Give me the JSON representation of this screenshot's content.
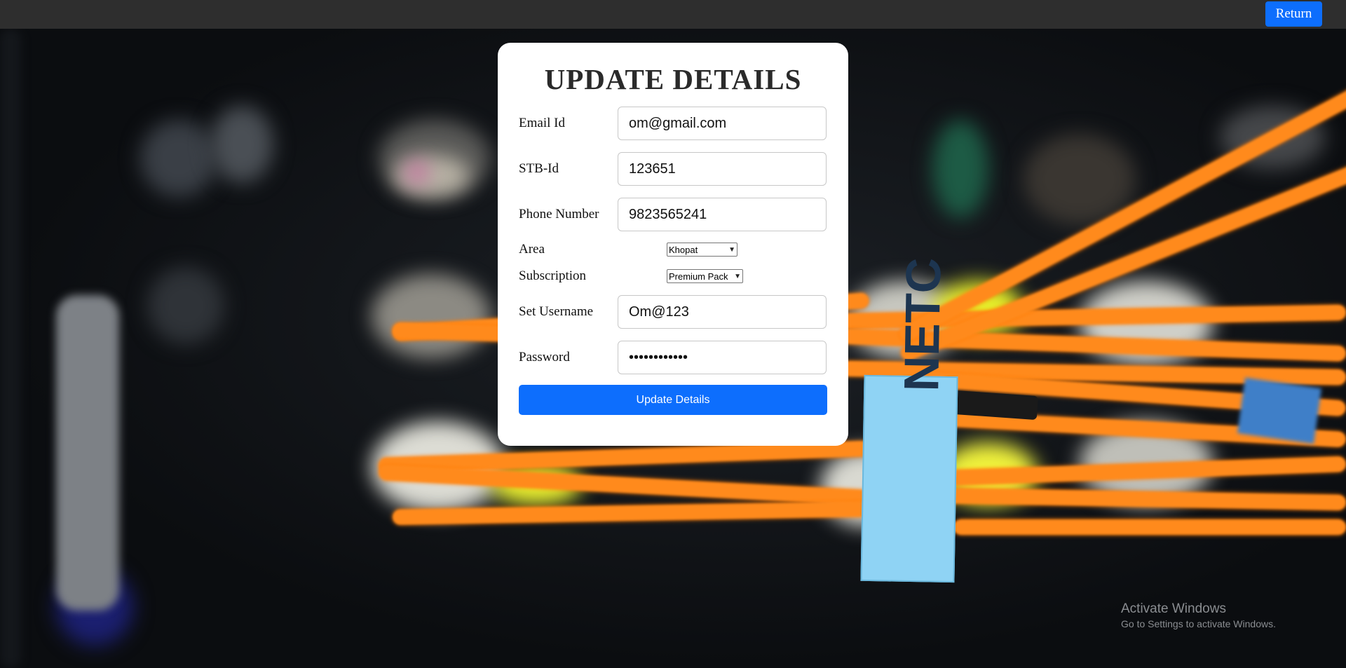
{
  "topbar": {
    "return_label": "Return"
  },
  "form": {
    "title": "UPDATE DETAILS",
    "fields": {
      "email": {
        "label": "Email Id",
        "value": "om@gmail.com"
      },
      "stb": {
        "label": "STB-Id",
        "value": "123651"
      },
      "phone": {
        "label": "Phone Number",
        "value": "9823565241"
      },
      "area": {
        "label": "Area",
        "selected": "Khopat"
      },
      "subscription": {
        "label": "Subscription",
        "selected": "Premium Pack"
      },
      "username": {
        "label": "Set Username",
        "value": "Om@123"
      },
      "password": {
        "label": "Password",
        "value": "••••••••••••"
      }
    },
    "submit_label": "Update Details"
  },
  "background": {
    "tag_text": "NETC"
  },
  "watermark": {
    "title": "Activate Windows",
    "subtitle": "Go to Settings to activate Windows."
  },
  "colors": {
    "accent": "#0d6efd",
    "topbar": "#2e2e2e",
    "cable": "#ff8a1c"
  },
  "icons": {
    "select_arrow": "chevron-down-icon"
  }
}
